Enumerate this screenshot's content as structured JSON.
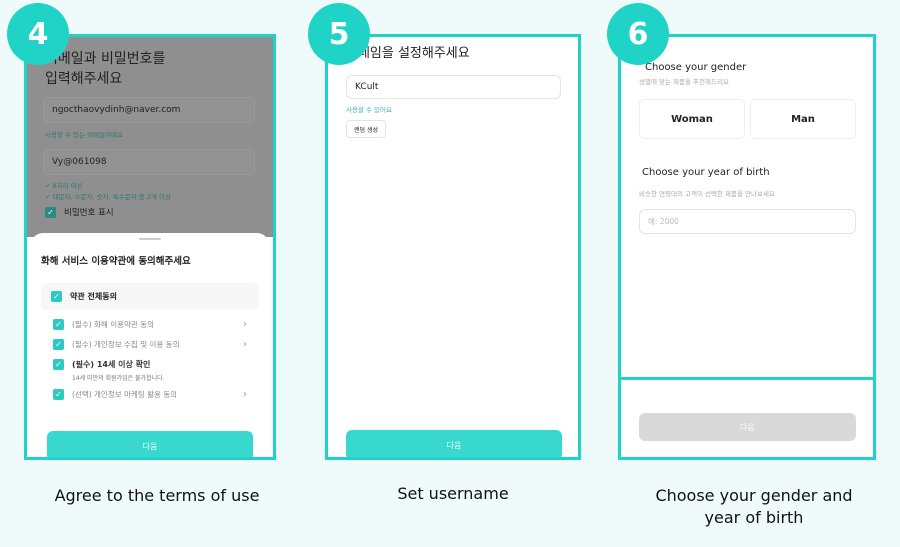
{
  "steps": [
    {
      "number": "4",
      "caption": "Agree to the terms of use"
    },
    {
      "number": "5",
      "caption": "Set username"
    },
    {
      "number": "6",
      "caption": "Choose your gender and year of birth"
    }
  ],
  "screen4": {
    "title": "이메일과 비밀번호를 입력해주세요",
    "email_value": "ngocthaovydinh@naver.com",
    "email_hint": "사용할 수 있는 이메일이에요",
    "password_value": "Vy@061098",
    "password_rules": [
      "8자리 이상",
      "대문자, 소문자, 숫자, 특수문자 중 2개 이상"
    ],
    "show_password_label": "비밀번호 표시",
    "sheet_title": "화해 서비스 이용약관에 동의해주세요",
    "agree_all": "약관 전체동의",
    "terms": [
      {
        "label": "(필수) 화해 이용약관 동의",
        "chevron": true
      },
      {
        "label": "(필수) 개인정보 수집 및 이용 동의",
        "chevron": true
      },
      {
        "label": "(필수) 14세 이상 확인",
        "sub": "14세 미만의 회원가입은 불가합니다.",
        "chevron": false
      },
      {
        "label": "(선택) 개인정보 마케팅 활용 동의",
        "chevron": true
      }
    ],
    "next_label": "다음"
  },
  "screen5": {
    "title": "닉네임을 설정해주세요",
    "nickname_value": "KCult",
    "hint": "사용할 수 있어요",
    "random_label": "랜덤 생성",
    "next_label": "다음"
  },
  "screen6": {
    "gender_title": "Choose your gender",
    "gender_sub": "성별에 맞는 제품을 추천해드리요",
    "woman": "Woman",
    "man": "Man",
    "year_title": "Choose your year of birth",
    "year_sub": "비슷한 연령대의 고객이 선택한 제품을 만나보세요",
    "year_placeholder": "예: 2000",
    "next_label": "다음"
  },
  "colors": {
    "accent": "#1fd3c6",
    "button": "#38d8cf",
    "hint": "#3bb5ad"
  }
}
